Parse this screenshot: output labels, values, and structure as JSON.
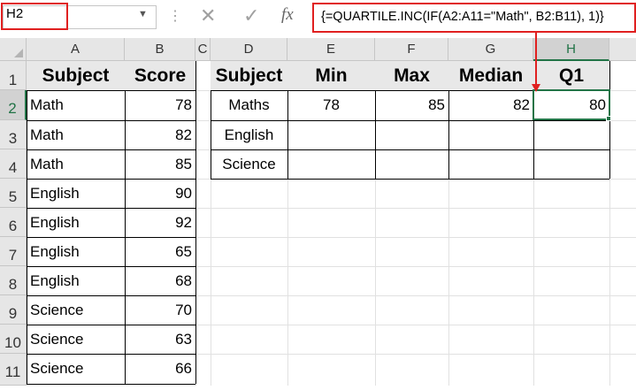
{
  "name_box": {
    "value": "H2"
  },
  "formula_bar": {
    "formula": "{=QUARTILE.INC(IF(A2:A11=\"Math\", B2:B11), 1)}",
    "fx_label": "fx",
    "cancel_icon": "✕",
    "enter_icon": "✓"
  },
  "columns": [
    "A",
    "B",
    "C",
    "D",
    "E",
    "F",
    "G",
    "H"
  ],
  "rows": [
    "1",
    "2",
    "3",
    "4",
    "5",
    "6",
    "7",
    "8",
    "9",
    "10",
    "11"
  ],
  "selected_cell": "H2",
  "table1": {
    "headers": [
      "Subject",
      "Score"
    ],
    "rows": [
      [
        "Math",
        "78"
      ],
      [
        "Math",
        "82"
      ],
      [
        "Math",
        "85"
      ],
      [
        "English",
        "90"
      ],
      [
        "English",
        "92"
      ],
      [
        "English",
        "65"
      ],
      [
        "English",
        "68"
      ],
      [
        "Science",
        "70"
      ],
      [
        "Science",
        "63"
      ],
      [
        "Science",
        "66"
      ]
    ]
  },
  "table2": {
    "headers": [
      "Subject",
      "Min",
      "Max",
      "Median",
      "Q1"
    ],
    "rows": [
      [
        "Maths",
        "78",
        "85",
        "82",
        "80"
      ],
      [
        "English",
        "",
        "",
        "",
        ""
      ],
      [
        "Science",
        "",
        "",
        "",
        ""
      ]
    ]
  },
  "colors": {
    "accent": "#217346",
    "highlight": "#e02020",
    "header_fill": "#e8e8e8"
  }
}
